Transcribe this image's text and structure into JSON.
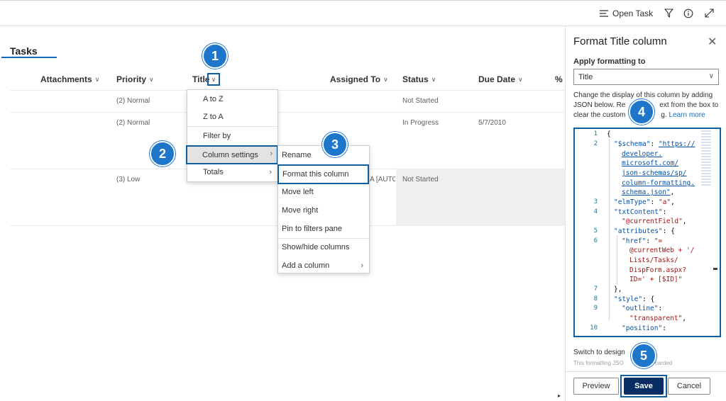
{
  "command_bar": {
    "open_task_label": "Open Task",
    "icons": [
      "list-icon",
      "filter-icon",
      "info-icon",
      "expand-icon"
    ]
  },
  "list": {
    "tab_label": "Tasks",
    "columns": [
      "Attachments",
      "Priority",
      "Title",
      "Assigned To",
      "Status",
      "Due Date",
      "% C"
    ],
    "rows": [
      {
        "priority": "(2) Normal",
        "assigned": "",
        "status": "Not Started",
        "due": ""
      },
      {
        "priority": "(2) Normal",
        "assigned": "",
        "status": "In Progress",
        "due": "5/7/2010"
      },
      {
        "priority": "(3) Low",
        "assigned": "A [AUTO...",
        "status": "Not Started",
        "due": ""
      }
    ]
  },
  "title_menu": {
    "items": [
      "A to Z",
      "Z to A",
      "Filter by",
      "Column settings",
      "Totals"
    ]
  },
  "column_settings_menu": {
    "items": [
      "Rename",
      "Format this column",
      "Move left",
      "Move right",
      "Pin to filters pane",
      "Show/hide columns",
      "Add a column"
    ]
  },
  "callouts": [
    "1",
    "2",
    "3",
    "4",
    "5"
  ],
  "panel": {
    "title": "Format Title column",
    "apply_label": "Apply formatting to",
    "apply_value": "Title",
    "description_line1": "Change the display of this column by adding",
    "description_line2": "JSON below. Re",
    "description_line2b": "ext from the box to",
    "description_line3": "clear the custom",
    "description_line3b": "g.",
    "learn_more": "Learn more",
    "line_numbers": [
      "1",
      "2",
      "3",
      "4",
      "5",
      "6",
      "7",
      "8",
      "9",
      "10"
    ],
    "code": {
      "l1": "{",
      "l2_key": "\"$schema\"",
      "l2_val": "\"https://",
      "l2_c1": "developer.",
      "l2_c2": "microsoft.com/",
      "l2_c3": "json-schemas/sp/",
      "l2_c4": "column-formatting.",
      "l2_c5": "schema.json\"",
      "l3_key": "\"elmType\"",
      "l3_val": "\"a\"",
      "l4_key": "\"txtContent\"",
      "l4_val": "\"@currentField\"",
      "l5_key": "\"attributes\"",
      "l6_key": "\"href\"",
      "l6_val": "\"=",
      "l6_c1": "@currentWeb + '/",
      "l6_c2": "Lists/Tasks/",
      "l6_c3": "DispForm.aspx?",
      "l6_c4": "ID=' + [$ID]\"",
      "l7": "},",
      "l8_key": "\"style\"",
      "l9_key": "\"outline\"",
      "l9_val": "\"transparent\"",
      "l10_key": "\"position\""
    },
    "switch_design": "Switch to design",
    "discard_note_a": "This formatting JSO",
    "discard_note_b": "carded",
    "buttons": {
      "preview": "Preview",
      "save": "Save",
      "cancel": "Cancel"
    }
  },
  "colors": {
    "accent": "#1d76c9",
    "save": "#062e63",
    "highlight": "#0f5ea1"
  }
}
